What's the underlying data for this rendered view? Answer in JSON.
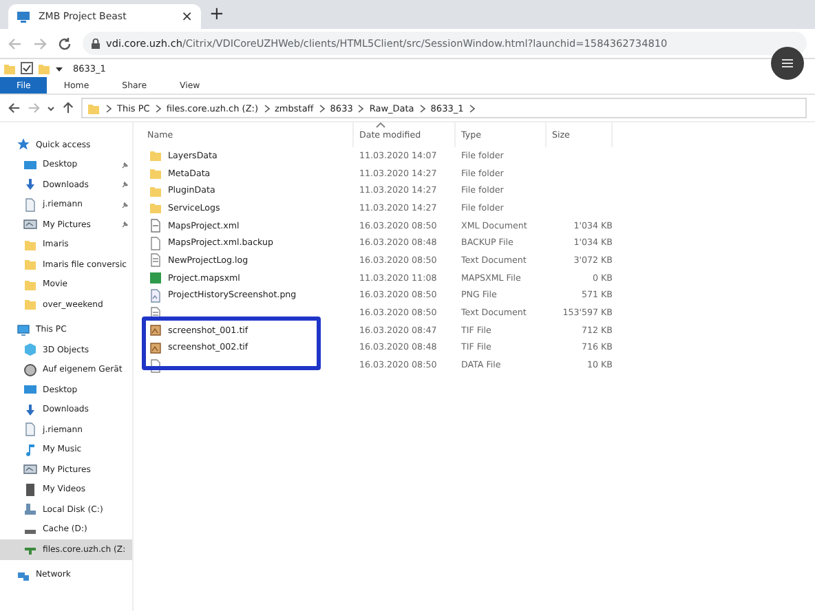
{
  "browser": {
    "tab_title": "ZMB Project Beast",
    "tab_close": "×",
    "new_tab": "+",
    "url_host": "vdi.core.uzh.ch",
    "url_path": "/Citrix/VDICoreUZHWeb/clients/HTML5Client/src/SessionWindow.html?launchid=1584362734810"
  },
  "explorer": {
    "title": "8633_1",
    "ribbon_tabs": [
      {
        "label": "File",
        "selected": true
      },
      {
        "label": "Home",
        "selected": false
      },
      {
        "label": "Share",
        "selected": false
      },
      {
        "label": "View",
        "selected": false
      }
    ],
    "breadcrumb": [
      "This PC",
      "files.core.uzh.ch (Z:)",
      "zmbstaff",
      "8633",
      "Raw_Data",
      "8633_1"
    ],
    "sidebar": [
      {
        "label": "Quick access",
        "kind": "star",
        "selected": false,
        "children": [
          {
            "label": "Desktop",
            "kind": "desktop",
            "pinned": true,
            "selected": false
          },
          {
            "label": "Downloads",
            "kind": "download",
            "pinned": true,
            "selected": false
          },
          {
            "label": "j.riemann",
            "kind": "doc",
            "pinned": true,
            "selected": false
          },
          {
            "label": "My Pictures",
            "kind": "pictures",
            "pinned": true,
            "selected": false
          },
          {
            "label": "Imaris",
            "kind": "folder",
            "pinned": false,
            "selected": false
          },
          {
            "label": "Imaris file conversic",
            "kind": "folder",
            "pinned": false,
            "selected": false
          },
          {
            "label": "Movie",
            "kind": "folder",
            "pinned": false,
            "selected": false
          },
          {
            "label": "over_weekend",
            "kind": "folder",
            "pinned": false,
            "selected": false
          }
        ]
      },
      {
        "label": "This PC",
        "kind": "pc",
        "selected": false,
        "children": [
          {
            "label": "3D Objects",
            "kind": "cube",
            "pinned": false,
            "selected": false
          },
          {
            "label": "Auf eigenem Gerät",
            "kind": "globe",
            "pinned": false,
            "selected": false
          },
          {
            "label": "Desktop",
            "kind": "desktop",
            "pinned": false,
            "selected": false
          },
          {
            "label": "Downloads",
            "kind": "download",
            "pinned": false,
            "selected": false
          },
          {
            "label": "j.riemann",
            "kind": "doc",
            "pinned": false,
            "selected": false
          },
          {
            "label": "My Music",
            "kind": "music",
            "pinned": false,
            "selected": false
          },
          {
            "label": "My Pictures",
            "kind": "pictures",
            "pinned": false,
            "selected": false
          },
          {
            "label": "My Videos",
            "kind": "videos",
            "pinned": false,
            "selected": false
          },
          {
            "label": "Local Disk (C:)",
            "kind": "disk",
            "pinned": false,
            "selected": false
          },
          {
            "label": "Cache (D:)",
            "kind": "drive",
            "pinned": false,
            "selected": false
          },
          {
            "label": "files.core.uzh.ch (Z:",
            "kind": "netdrive",
            "pinned": false,
            "selected": true
          }
        ]
      },
      {
        "label": "Network",
        "kind": "network",
        "selected": false
      }
    ],
    "columns": [
      "Name",
      "Date modified",
      "Type",
      "Size"
    ],
    "files": [
      {
        "name": "LayersData",
        "date": "11.03.2020 14:07",
        "type": "File folder",
        "kind": "folder"
      },
      {
        "name": "MetaData",
        "date": "11.03.2020 14:27",
        "type": "File folder",
        "kind": "folder"
      },
      {
        "name": "PluginData",
        "date": "11.03.2020 14:27",
        "type": "File folder",
        "kind": "folder"
      },
      {
        "name": "ServiceLogs",
        "date": "11.03.2020 14:27",
        "type": "File folder",
        "kind": "folder"
      },
      {
        "name": "MapsProject.xml",
        "date": "16.03.2020 08:50",
        "type": "XML Document",
        "size": "1'034 KB",
        "kind": "xml"
      },
      {
        "name": "MapsProject.xml.backup",
        "date": "16.03.2020 08:48",
        "type": "BACKUP File",
        "size": "1'034 KB",
        "kind": "blank"
      },
      {
        "name": "NewProjectLog.log",
        "date": "16.03.2020 08:50",
        "type": "Text Document",
        "size": "3'072 KB",
        "kind": "text"
      },
      {
        "name": "Project.mapsxml",
        "date": "11.03.2020 11:08",
        "type": "MAPSXML File",
        "size": "0 KB",
        "kind": "maps"
      },
      {
        "name": "ProjectHistoryScreenshot.png",
        "date": "16.03.2020 08:50",
        "type": "PNG File",
        "size": "571 KB",
        "kind": "image"
      },
      {
        "date": "16.03.2020 08:50",
        "type": "Text Document",
        "size": "153'597 KB",
        "kind": "text"
      },
      {
        "name": "screenshot_001.tif",
        "date": "16.03.2020 08:47",
        "type": "TIF File",
        "size": "712 KB",
        "kind": "tif"
      },
      {
        "name": "screenshot_002.tif",
        "date": "16.03.2020 08:48",
        "type": "TIF File",
        "size": "716 KB",
        "kind": "tif"
      },
      {
        "date": "16.03.2020 08:50",
        "type": "DATA File",
        "size": "10 KB",
        "kind": "blank"
      }
    ]
  }
}
